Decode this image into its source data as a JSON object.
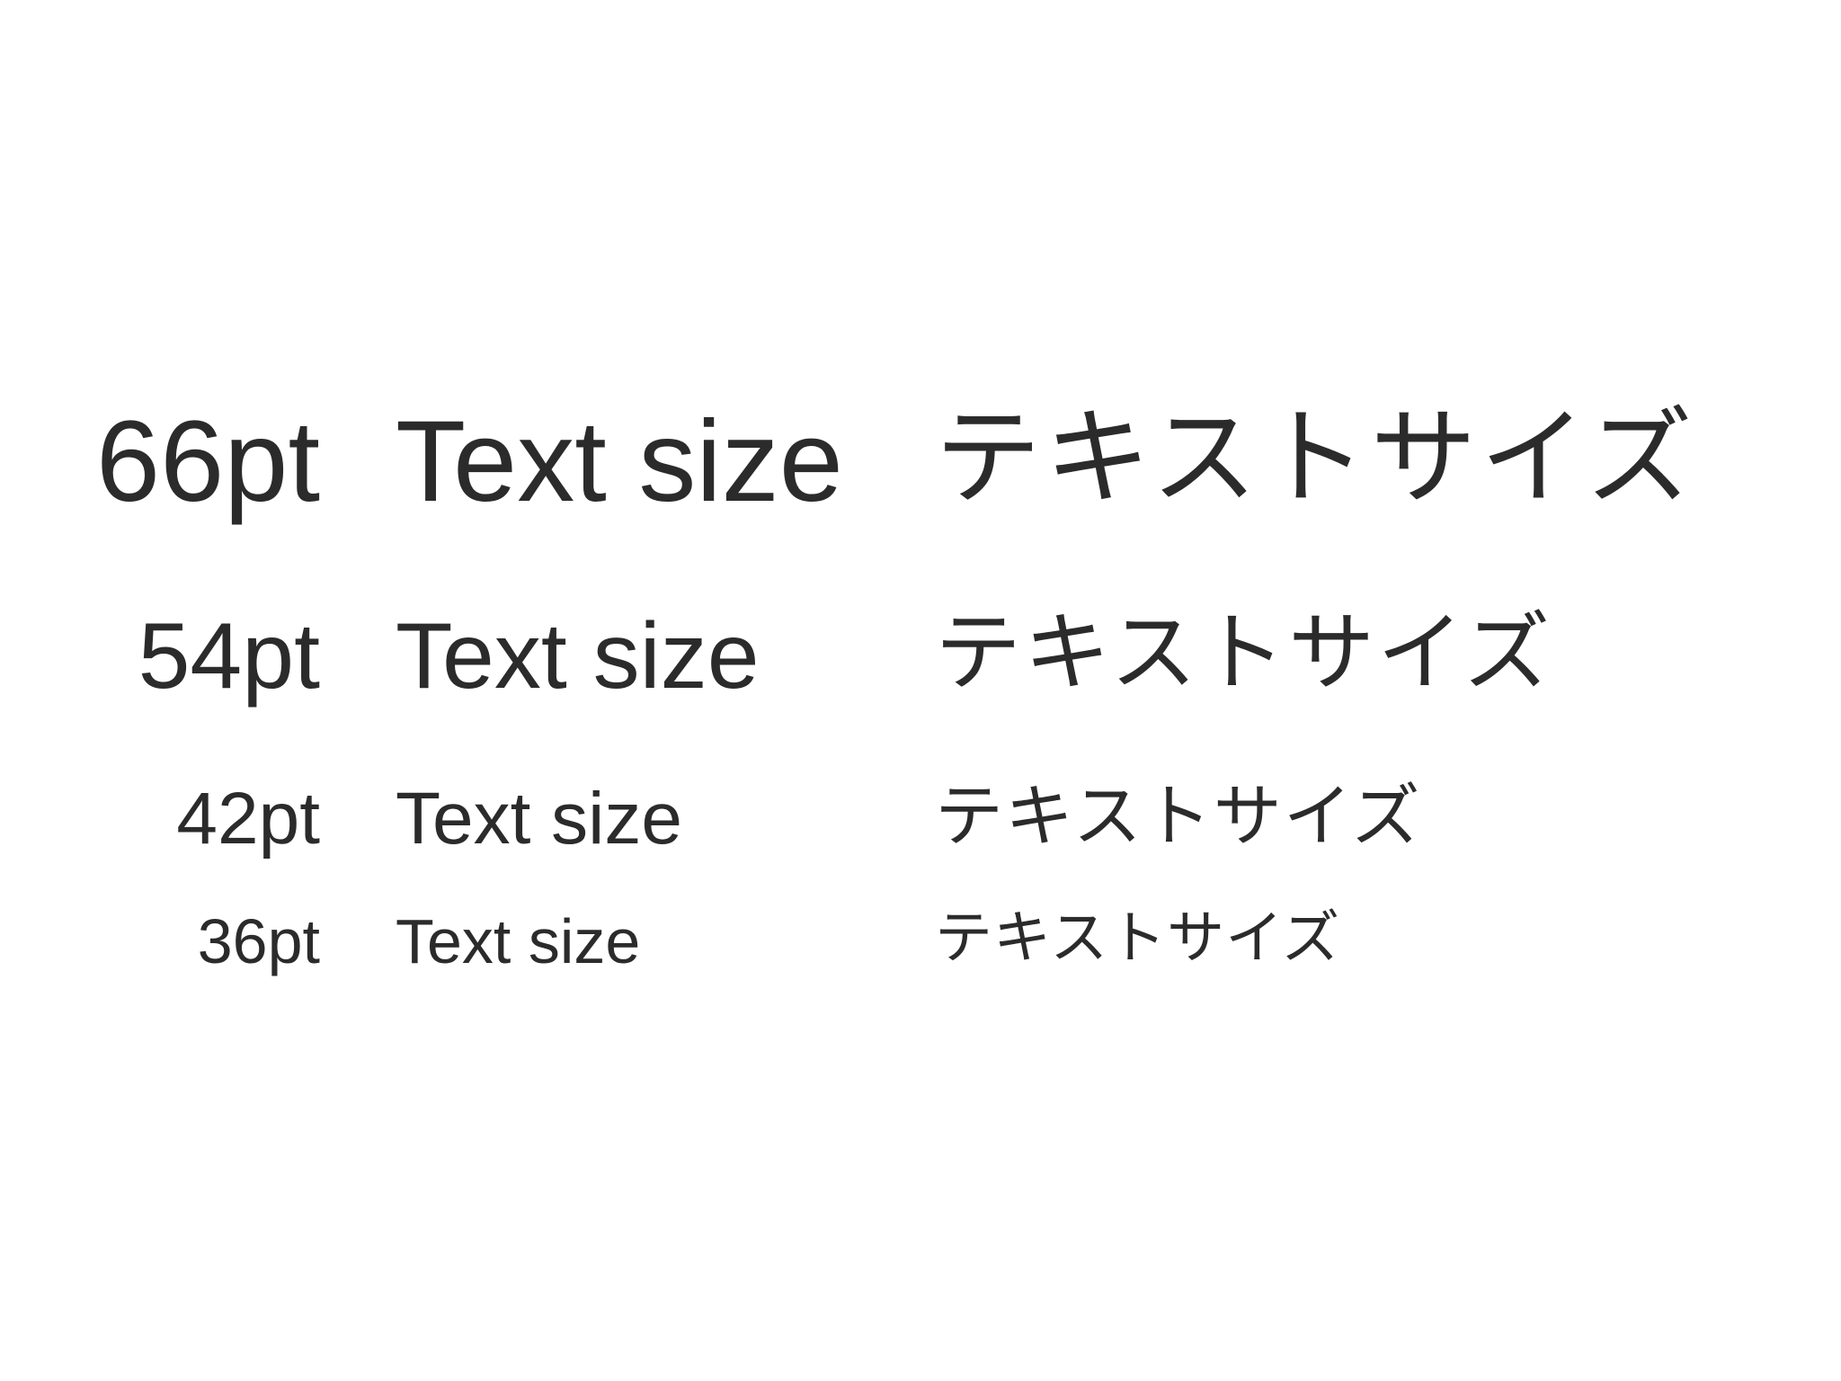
{
  "text_color": "#2b2b2b",
  "background_color": "#ffffff",
  "rows": [
    {
      "size_label": "66pt",
      "latin_sample": "Text size",
      "japanese_sample": "テキストサイズ"
    },
    {
      "size_label": "54pt",
      "latin_sample": "Text size",
      "japanese_sample": "テキストサイズ"
    },
    {
      "size_label": "42pt",
      "latin_sample": "Text size",
      "japanese_sample": "テキストサイズ"
    },
    {
      "size_label": "36pt",
      "latin_sample": "Text size",
      "japanese_sample": "テキストサイズ"
    }
  ]
}
